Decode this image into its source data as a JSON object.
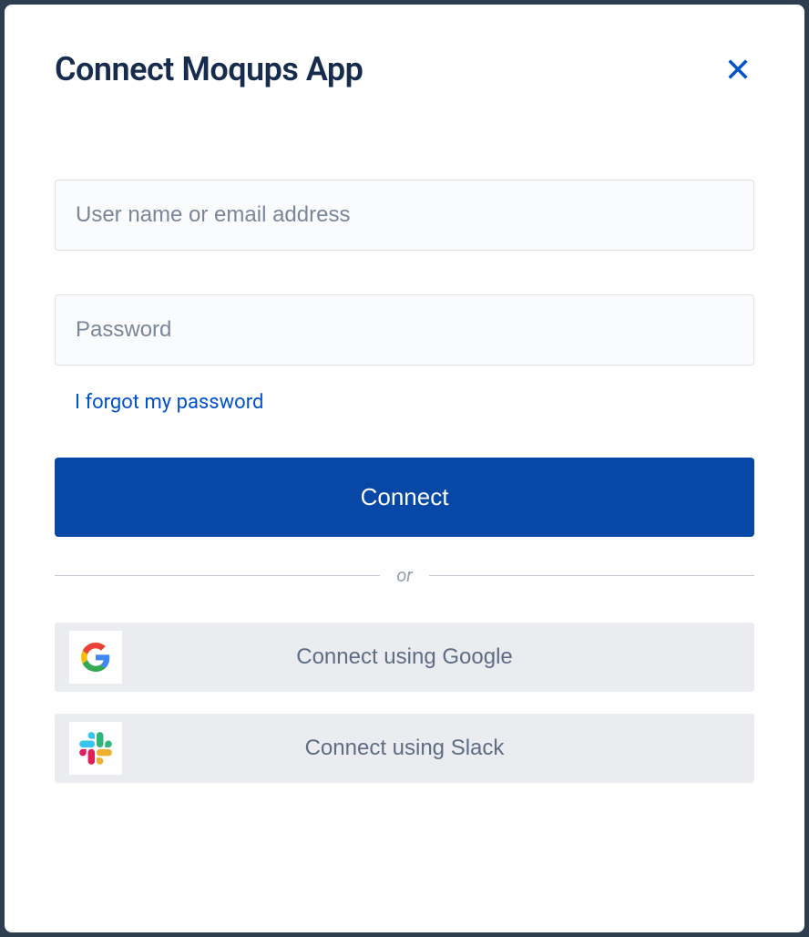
{
  "header": {
    "title": "Connect Moqups App"
  },
  "form": {
    "username_placeholder": "User name or email address",
    "password_placeholder": "Password",
    "forgot_password_label": "I forgot my password",
    "connect_label": "Connect"
  },
  "divider": {
    "text": "or"
  },
  "social": {
    "google_label": "Connect using Google",
    "slack_label": "Connect using Slack"
  }
}
